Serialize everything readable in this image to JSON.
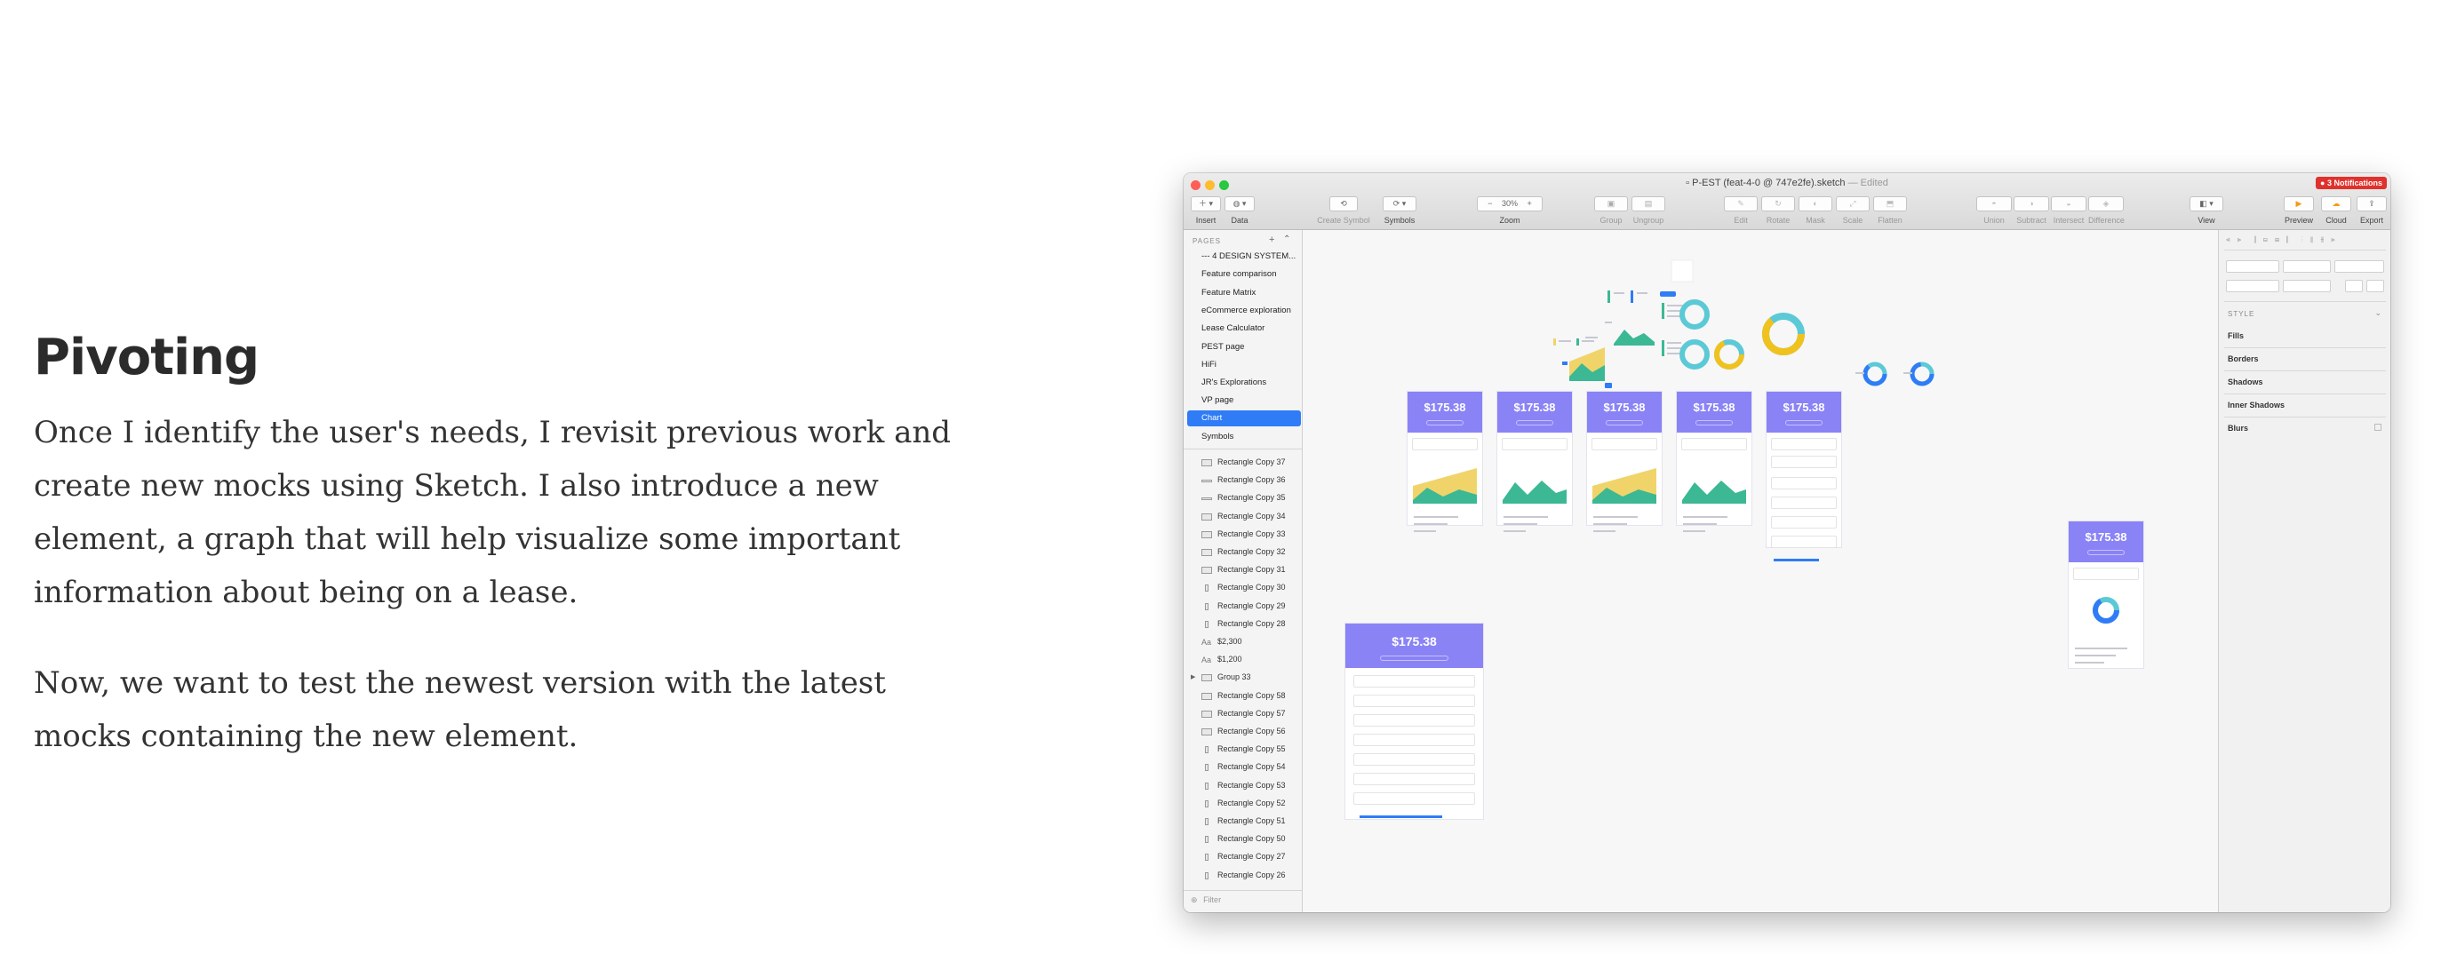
{
  "article": {
    "heading": "Pivoting",
    "paragraphs": [
      "Once I identify the user's needs, I revisit previous work and create new mocks using Sketch. I also introduce a new element, a graph that will help visualize some important information about being on a lease.",
      "Now, we want to test the newest version with the latest mocks containing the new element."
    ]
  },
  "window": {
    "title": "P-EST (feat-4-0 @ 747e2fe).sketch",
    "edited": "— Edited",
    "notifications": "3 Notifications",
    "zoom": "30%",
    "toolbar": {
      "insert": "Insert",
      "data": "Data",
      "create_symbol": "Create Symbol",
      "symbols": "Symbols",
      "zoom": "Zoom",
      "group": "Group",
      "ungroup": "Ungroup",
      "edit": "Edit",
      "rotate": "Rotate",
      "mask": "Mask",
      "scale": "Scale",
      "flatten": "Flatten",
      "union": "Union",
      "subtract": "Subtract",
      "intersect": "Intersect",
      "difference": "Difference",
      "view": "View",
      "preview": "Preview",
      "cloud": "Cloud",
      "export": "Export"
    },
    "pages_header": "PAGES",
    "pages": [
      "--- 4 DESIGN SYSTEM...",
      "Feature comparison",
      "Feature Matrix",
      "eCommerce exploration",
      "Lease Calculator",
      "PEST page",
      "HiFi",
      "JR's Explorations",
      "VP page",
      "Chart",
      "Symbols"
    ],
    "selected_page": "Chart",
    "layers": [
      {
        "name": "Rectangle Copy 37",
        "icon": "rect"
      },
      {
        "name": "Rectangle Copy 36",
        "icon": "line"
      },
      {
        "name": "Rectangle Copy 35",
        "icon": "line"
      },
      {
        "name": "Rectangle Copy 34",
        "icon": "rect"
      },
      {
        "name": "Rectangle Copy 33",
        "icon": "rect"
      },
      {
        "name": "Rectangle Copy 32",
        "icon": "rect"
      },
      {
        "name": "Rectangle Copy 31",
        "icon": "rect"
      },
      {
        "name": "Rectangle Copy 30",
        "icon": "thin"
      },
      {
        "name": "Rectangle Copy 29",
        "icon": "thin"
      },
      {
        "name": "Rectangle Copy 28",
        "icon": "thin"
      },
      {
        "name": "$2,300",
        "icon": "text"
      },
      {
        "name": "$1,200",
        "icon": "text"
      },
      {
        "name": "Group 33",
        "icon": "group"
      },
      {
        "name": "Rectangle Copy 58",
        "icon": "rect"
      },
      {
        "name": "Rectangle Copy 57",
        "icon": "rect"
      },
      {
        "name": "Rectangle Copy 56",
        "icon": "rect"
      },
      {
        "name": "Rectangle Copy 55",
        "icon": "thin"
      },
      {
        "name": "Rectangle Copy 54",
        "icon": "thin"
      },
      {
        "name": "Rectangle Copy 53",
        "icon": "thin"
      },
      {
        "name": "Rectangle Copy 52",
        "icon": "thin"
      },
      {
        "name": "Rectangle Copy 51",
        "icon": "thin"
      },
      {
        "name": "Rectangle Copy 50",
        "icon": "thin"
      },
      {
        "name": "Rectangle Copy 27",
        "icon": "thin"
      },
      {
        "name": "Rectangle Copy 26",
        "icon": "thin"
      }
    ],
    "filter_placeholder": "Filter",
    "inspector": {
      "style": "STYLE",
      "fills": "Fills",
      "borders": "Borders",
      "shadows": "Shadows",
      "inner_shadows": "Inner Shadows",
      "blurs": "Blurs"
    },
    "artboard_price": "$175.38",
    "colors": {
      "card_header": "#8a83f6",
      "area_yellow": "#f0d46a",
      "area_green": "#3cb894",
      "donut_blue": "#2f7cf6",
      "donut_teal": "#5cc9d6",
      "selection": "#2f7cf6"
    }
  }
}
